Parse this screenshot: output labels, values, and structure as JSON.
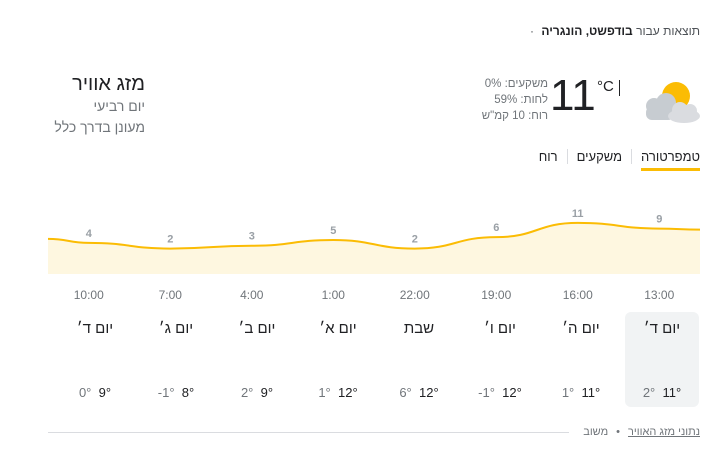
{
  "header": {
    "results_for_label": "תוצאות עבור",
    "location": "בודפשט, הונגריה",
    "dot": "·"
  },
  "weather": {
    "title": "מזג אוויר",
    "day": "יום רביעי",
    "condition": "מעונן בדרך כלל",
    "temperature": "11",
    "unit": "°C",
    "icon": "partly-cloudy-icon",
    "precipitation": "משקעים: 0%",
    "humidity": "לחות: 59%",
    "wind": "רוח: 10 קמ\"ש"
  },
  "tabs": [
    {
      "label": "טמפרטורה",
      "active": true
    },
    {
      "label": "משקעים",
      "active": false
    },
    {
      "label": "רוח",
      "active": false
    }
  ],
  "chart_data": {
    "type": "area",
    "x": [
      "13:00",
      "16:00",
      "19:00",
      "22:00",
      "1:00",
      "4:00",
      "7:00",
      "10:00"
    ],
    "values": [
      9,
      11,
      6,
      2,
      5,
      3,
      2,
      4
    ],
    "colors": {
      "line": "#fbbc04",
      "fill": "#fef7e0",
      "label": "#9aa0a6"
    }
  },
  "forecast": [
    {
      "day": "יום ד׳",
      "hi": "11°",
      "lo": "2°",
      "selected": true
    },
    {
      "day": "יום ה׳",
      "hi": "11°",
      "lo": "1°",
      "selected": false
    },
    {
      "day": "יום ו׳",
      "hi": "12°",
      "lo": "-1°",
      "selected": false
    },
    {
      "day": "שבת",
      "hi": "12°",
      "lo": "6°",
      "selected": false
    },
    {
      "day": "יום א׳",
      "hi": "12°",
      "lo": "1°",
      "selected": false
    },
    {
      "day": "יום ב׳",
      "hi": "9°",
      "lo": "2°",
      "selected": false
    },
    {
      "day": "יום ג׳",
      "hi": "8°",
      "lo": "-1°",
      "selected": false
    },
    {
      "day": "יום ד׳",
      "hi": "9°",
      "lo": "0°",
      "selected": false
    }
  ],
  "footer": {
    "data_link": "נתוני מזג האוויר",
    "separator": "•",
    "feedback": "משוב"
  }
}
